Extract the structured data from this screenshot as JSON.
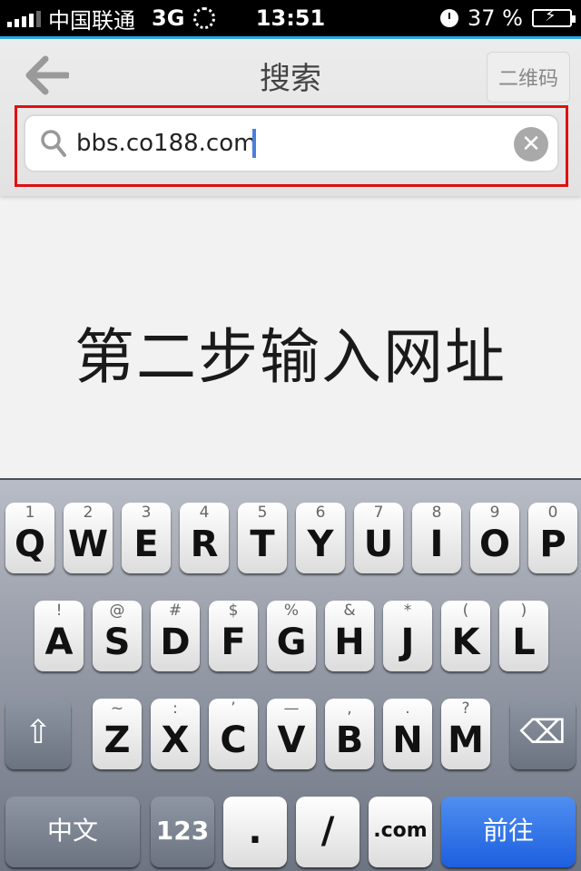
{
  "status_bar": {
    "carrier": "中国联通",
    "network": "3G",
    "time": "13:51",
    "battery": "37 %"
  },
  "header": {
    "title": "搜索",
    "qr_button": "二维码"
  },
  "search": {
    "value": "bbs.co188.com",
    "clear_icon": "✕"
  },
  "instruction_text": "第二步输入网址",
  "keyboard": {
    "row1": [
      {
        "sub": "1",
        "key": "Q"
      },
      {
        "sub": "2",
        "key": "W"
      },
      {
        "sub": "3",
        "key": "E"
      },
      {
        "sub": "4",
        "key": "R"
      },
      {
        "sub": "5",
        "key": "T"
      },
      {
        "sub": "6",
        "key": "Y"
      },
      {
        "sub": "7",
        "key": "U"
      },
      {
        "sub": "8",
        "key": "I"
      },
      {
        "sub": "9",
        "key": "O"
      },
      {
        "sub": "0",
        "key": "P"
      }
    ],
    "row2": [
      {
        "sub": "!",
        "key": "A"
      },
      {
        "sub": "@",
        "key": "S"
      },
      {
        "sub": "#",
        "key": "D"
      },
      {
        "sub": "$",
        "key": "F"
      },
      {
        "sub": "%",
        "key": "G"
      },
      {
        "sub": "&",
        "key": "H"
      },
      {
        "sub": "*",
        "key": "J"
      },
      {
        "sub": "(",
        "key": "K"
      },
      {
        "sub": ")",
        "key": "L"
      }
    ],
    "row3": [
      {
        "sub": "~",
        "key": "Z"
      },
      {
        "sub": ":",
        "key": "X"
      },
      {
        "sub": "’",
        "key": "C"
      },
      {
        "sub": "—",
        "key": "V"
      },
      {
        "sub": ",",
        "key": "B"
      },
      {
        "sub": ".",
        "key": "N"
      },
      {
        "sub": "?",
        "key": "M"
      }
    ],
    "shift_icon": "⇧",
    "backspace_icon": "⌫",
    "chinese_key": "中文",
    "numbers_key": "123",
    "dot_key": ".",
    "slash_key": "/",
    "dotcom_key": ".com",
    "go_key": "前往"
  },
  "colors": {
    "accent_blue": "#29a8e0",
    "highlight_red": "#e01010",
    "go_key_blue": "#1d5fe0"
  }
}
